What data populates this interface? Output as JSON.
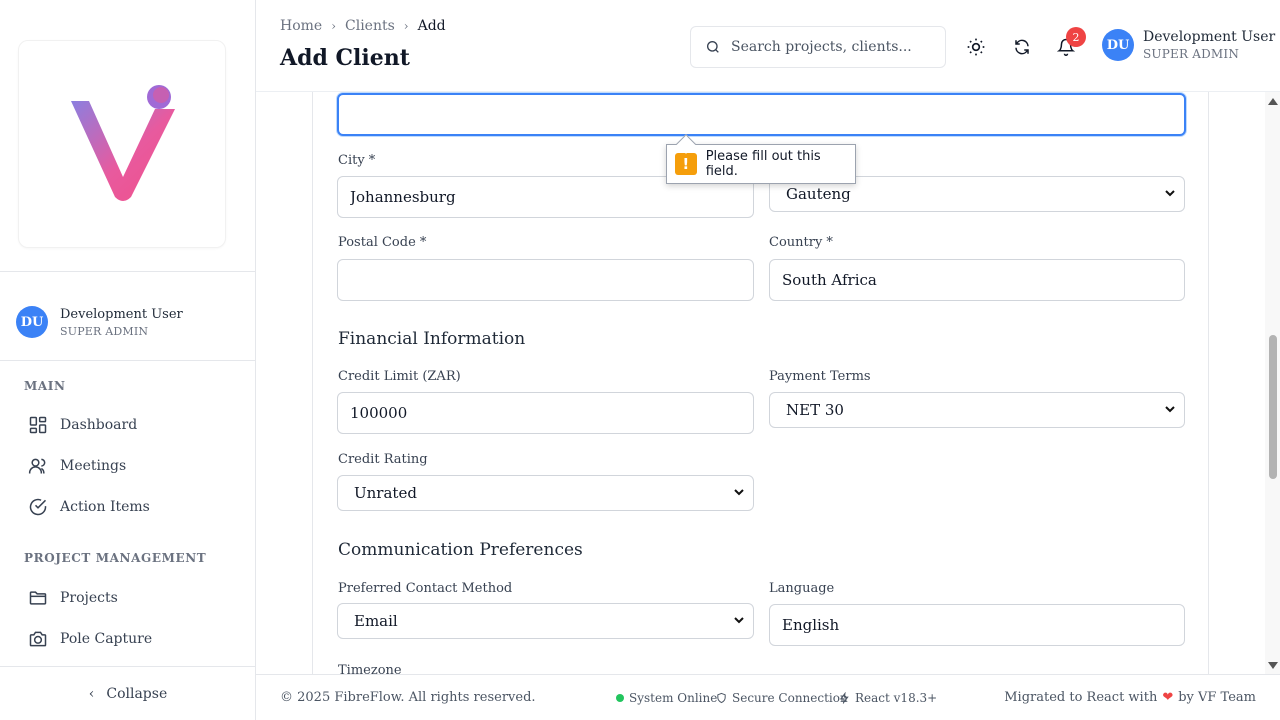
{
  "sidebar": {
    "user": {
      "initials": "DU",
      "name": "Development User",
      "role": "SUPER ADMIN"
    },
    "sections": [
      {
        "title": "MAIN",
        "items": [
          {
            "label": "Dashboard",
            "icon": "dashboard-grid-icon"
          },
          {
            "label": "Meetings",
            "icon": "users-icon"
          },
          {
            "label": "Action Items",
            "icon": "check-circle-icon"
          }
        ]
      },
      {
        "title": "PROJECT MANAGEMENT",
        "items": [
          {
            "label": "Projects",
            "icon": "folder-icon"
          },
          {
            "label": "Pole Capture",
            "icon": "camera-icon"
          }
        ]
      }
    ],
    "collapse_label": "Collapse"
  },
  "header": {
    "breadcrumb": [
      "Home",
      "Clients",
      "Add"
    ],
    "title": "Add Client",
    "search_placeholder": "Search projects, clients...",
    "notification_count": "2",
    "user": {
      "initials": "DU",
      "name": "Development User",
      "role": "SUPER ADMIN"
    }
  },
  "form": {
    "address_value": "",
    "tooltip": "Please fill out this field.",
    "city": {
      "label": "City *",
      "value": "Johannesburg"
    },
    "province": {
      "value": "Gauteng"
    },
    "postal_code": {
      "label": "Postal Code *",
      "value": ""
    },
    "country": {
      "label": "Country *",
      "value": "South Africa"
    },
    "financial": {
      "title": "Financial Information",
      "credit_limit": {
        "label": "Credit Limit (ZAR)",
        "value": "100000"
      },
      "payment_terms": {
        "label": "Payment Terms",
        "value": "NET 30"
      },
      "credit_rating": {
        "label": "Credit Rating",
        "value": "Unrated"
      }
    },
    "communication": {
      "title": "Communication Preferences",
      "contact_method": {
        "label": "Preferred Contact Method",
        "value": "Email"
      },
      "language": {
        "label": "Language",
        "value": "English"
      },
      "timezone": {
        "label": "Timezone"
      }
    }
  },
  "footer": {
    "copyright": "© 2025 FibreFlow. All rights reserved.",
    "status_online": "System Online",
    "secure": "Secure Connection",
    "react": "React v18.3+",
    "credit_prefix": "Migrated to React with",
    "credit_suffix": "by VF Team"
  },
  "colors": {
    "accent": "#3b82f6",
    "badge": "#ef4444",
    "online": "#22c55e",
    "warning": "#f59e0b",
    "logo_from": "#8b5cf6",
    "logo_to": "#ec4899"
  }
}
